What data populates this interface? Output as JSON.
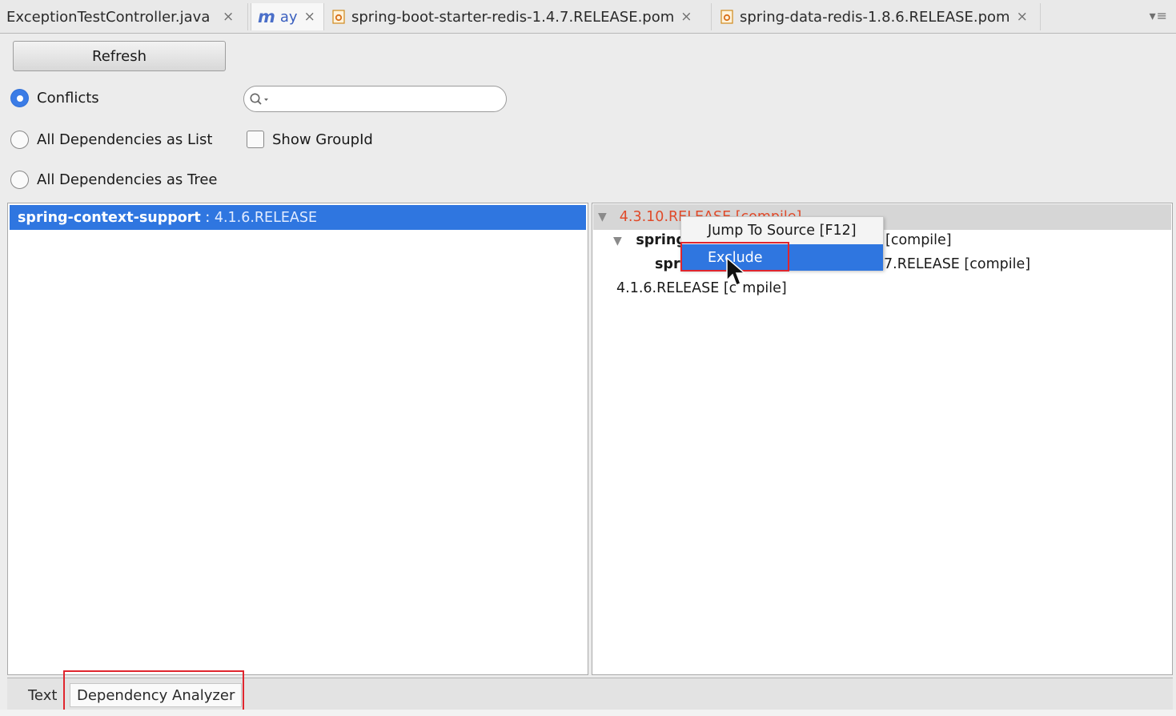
{
  "editor_tabs": [
    {
      "label": "ExceptionTestController.java",
      "icon": "java-class-icon"
    },
    {
      "label": "ay",
      "icon": "maven-m-icon"
    },
    {
      "label": "spring-boot-starter-redis-1.4.7.RELEASE.pom",
      "icon": "pom-file-icon"
    },
    {
      "label": "spring-data-redis-1.8.6.RELEASE.pom",
      "icon": "pom-file-icon"
    }
  ],
  "close_glyph": "×",
  "tab_menu_glyph": "▾≡",
  "toolbar": {
    "refresh_label": "Refresh",
    "search_placeholder": ""
  },
  "view_options": {
    "conflicts": "Conflicts",
    "all_list": "All Dependencies as List",
    "all_tree": "All Dependencies as Tree",
    "selected": "conflicts"
  },
  "show_group_id": {
    "label": "Show GroupId",
    "checked": false
  },
  "left_list": {
    "items": [
      {
        "artifact": "spring-context-support",
        "sep": " : ",
        "version": "4.1.6.RELEASE"
      }
    ]
  },
  "right_tree": {
    "header_text": "4.3.10.RELEASE [compile]",
    "row1_prefix": "spring",
    "row1_suffix": "[compile]",
    "row2_prefix": "spri",
    "row2_suffix": "7.RELEASE [compile]",
    "row3_a": "4.1.6.RELEASE [c",
    "row3_b": "mpile]"
  },
  "context_menu": {
    "items": [
      "Jump To Source [F12]",
      "Exclude"
    ],
    "selected_index": 1
  },
  "bottom_tabs": {
    "text": "Text",
    "analyzer": "Dependency Analyzer",
    "active": "Dependency Analyzer"
  },
  "colors": {
    "selection": "#2f76e0",
    "conflict_text": "#e04a2a",
    "highlight_box": "#e0262e"
  }
}
